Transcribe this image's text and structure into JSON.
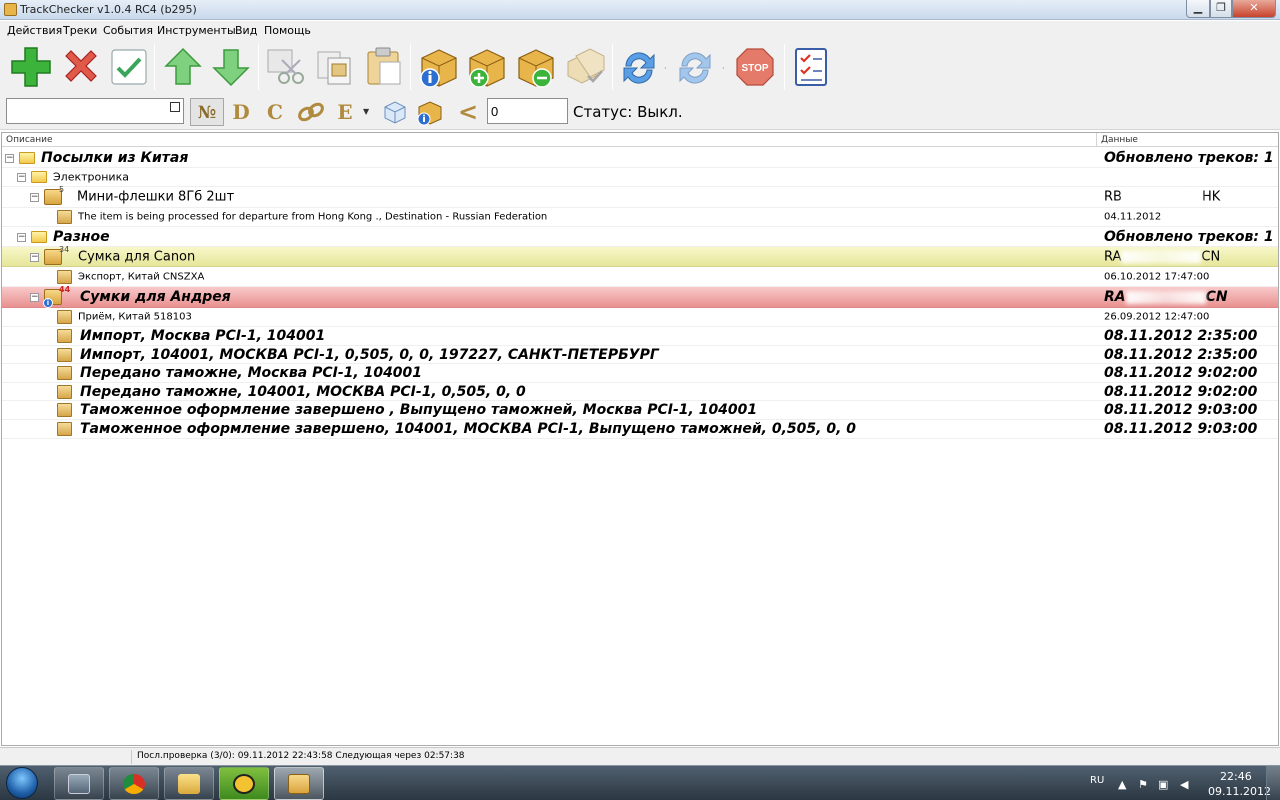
{
  "window": {
    "title": "TrackChecker v1.0.4 RC4 (b295)",
    "min_glyph": "▁",
    "max_glyph": "❐",
    "close_glyph": "✕"
  },
  "menu": [
    "Действия",
    "Треки",
    "События",
    "Инструменты",
    "Вид",
    "Помощь"
  ],
  "toolbar2": {
    "search_value": "",
    "filter_num": "№",
    "filter_d": "D",
    "filter_c": "C",
    "filter_e": "E",
    "less_than": "<",
    "count_value": "0",
    "status": "Статус: Выкл."
  },
  "tree": {
    "col_description": "Описание",
    "col_data": "Данные",
    "rows": [
      {
        "label": "Посылки из Китая",
        "data": "Обновлено треков: 1"
      },
      {
        "label": "Электроника",
        "data": ""
      },
      {
        "label": "Мини-флешки 8Гб 2шт",
        "badge": "5",
        "data": "RB",
        "data_suffix": "HK"
      },
      {
        "label": "The item is being processed for departure from Hong Kong ., Destination - Russian Federation",
        "data": "04.11.2012"
      },
      {
        "label": "Разное",
        "data": "Обновлено треков: 1"
      },
      {
        "label": "Сумка для Canon",
        "badge": "34",
        "data": "RA",
        "data_suffix": "CN"
      },
      {
        "label": "Экспорт, Китай CNSZXA",
        "data": "06.10.2012 17:47:00"
      },
      {
        "label": "Сумки для Андрея",
        "badge": "44",
        "data": "RA",
        "data_suffix": "CN"
      },
      {
        "label": "Приём, Китай 518103",
        "data": "26.09.2012 12:47:00"
      },
      {
        "label": "Импорт, Москва PCI-1, 104001",
        "data": "08.11.2012 2:35:00"
      },
      {
        "label": "Импорт, 104001, МОСКВА PCI-1, 0,505, 0, 0, 197227, САНКТ-ПЕТЕРБУРГ",
        "data": "08.11.2012 2:35:00"
      },
      {
        "label": "Передано таможне, Москва PCI-1, 104001",
        "data": "08.11.2012 9:02:00"
      },
      {
        "label": "Передано таможне, 104001, МОСКВА PCI-1, 0,505, 0, 0",
        "data": "08.11.2012 9:02:00"
      },
      {
        "label": "Таможенное оформление завершено , Выпущено таможней, Москва PCI-1, 104001",
        "data": "08.11.2012 9:03:00"
      },
      {
        "label": "Таможенное оформление завершено, 104001, МОСКВА PCI-1, Выпущено таможней, 0,505, 0, 0",
        "data": "08.11.2012 9:03:00"
      }
    ]
  },
  "statusbar": {
    "text": "Посл.проверка (3/0): 09.11.2012 22:43:58 Следующая через  02:57:38"
  },
  "taskbar": {
    "lang": "RU",
    "time": "22:46",
    "date": "09.11.2012"
  },
  "colors": {
    "highlight_yellow": "#e6e69a",
    "highlight_red": "#e99090",
    "accent_green": "#3cb43c",
    "accent_red": "#d83a2a"
  }
}
